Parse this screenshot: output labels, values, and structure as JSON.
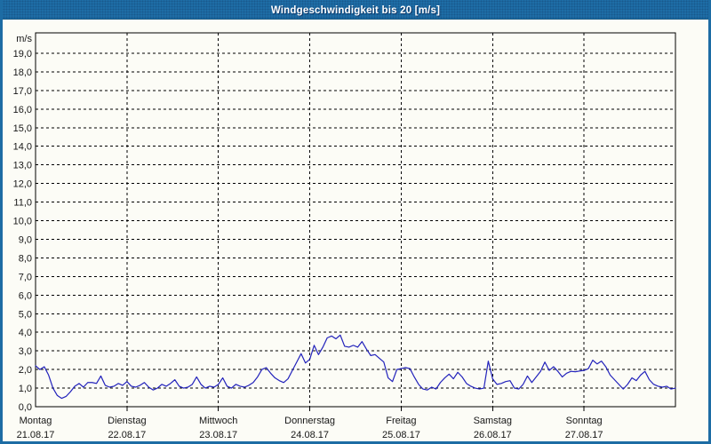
{
  "window": {
    "title": "Windgeschwindigkeit bis 20 [m/s]",
    "titlebar_color": "#1e6da6",
    "border_color": "#1d6ca4",
    "background_color": "#fcfcf6"
  },
  "chart_data": {
    "type": "line",
    "title": "Windgeschwindigkeit bis 20 [m/s]",
    "unit_label": "m/s",
    "ylabel": "m/s",
    "ylim": [
      0,
      20
    ],
    "y_tick_step": 1.0,
    "y_tick_labels": [
      "0,0",
      "1,0",
      "2,0",
      "3,0",
      "4,0",
      "5,0",
      "6,0",
      "7,0",
      "8,0",
      "9,0",
      "10,0",
      "11,0",
      "12,0",
      "13,0",
      "14,0",
      "15,0",
      "16,0",
      "17,0",
      "18,0",
      "19,0"
    ],
    "grid": "dashed",
    "line_color": "#2222bb",
    "grid_color": "#000000",
    "x_axis_days": [
      {
        "name": "Montag",
        "date": "21.08.17"
      },
      {
        "name": "Dienstag",
        "date": "22.08.17"
      },
      {
        "name": "Mittwoch",
        "date": "23.08.17"
      },
      {
        "name": "Donnerstag",
        "date": "24.08.17"
      },
      {
        "name": "Freitag",
        "date": "25.08.17"
      },
      {
        "name": "Samstag",
        "date": "26.08.17"
      },
      {
        "name": "Sonntag",
        "date": "27.08.17"
      }
    ],
    "samples_per_day": 21,
    "series": [
      {
        "name": "Windgeschwindigkeit",
        "values": [
          2.2,
          2.0,
          2.15,
          1.7,
          1.0,
          0.6,
          0.45,
          0.55,
          0.8,
          1.1,
          1.25,
          1.05,
          1.3,
          1.3,
          1.25,
          1.65,
          1.15,
          1.05,
          1.1,
          1.25,
          1.15,
          1.35,
          1.1,
          1.05,
          1.15,
          1.3,
          1.05,
          0.9,
          1.0,
          1.2,
          1.1,
          1.25,
          1.45,
          1.1,
          1.0,
          1.05,
          1.2,
          1.6,
          1.2,
          1.0,
          1.1,
          1.05,
          1.2,
          1.55,
          1.1,
          1.0,
          1.2,
          1.1,
          1.05,
          1.15,
          1.3,
          1.6,
          2.0,
          2.1,
          1.8,
          1.55,
          1.4,
          1.3,
          1.5,
          1.95,
          2.4,
          2.85,
          2.35,
          2.55,
          3.3,
          2.8,
          3.2,
          3.7,
          3.8,
          3.65,
          3.85,
          3.25,
          3.2,
          3.3,
          3.2,
          3.5,
          3.1,
          2.75,
          2.8,
          2.6,
          2.4,
          1.55,
          1.35,
          2.0,
          2.05,
          2.1,
          2.05,
          1.6,
          1.2,
          0.95,
          0.9,
          1.05,
          0.95,
          1.3,
          1.55,
          1.75,
          1.5,
          1.85,
          1.6,
          1.25,
          1.1,
          1.0,
          0.95,
          1.0,
          2.45,
          1.5,
          1.2,
          1.25,
          1.35,
          1.4,
          1.0,
          0.95,
          1.2,
          1.65,
          1.3,
          1.6,
          1.9,
          2.4,
          1.95,
          2.15,
          1.9,
          1.6,
          1.8,
          1.9,
          1.88,
          1.92,
          1.95,
          2.05,
          2.5,
          2.3,
          2.45,
          2.15,
          1.7,
          1.45,
          1.2,
          0.95,
          1.2,
          1.55,
          1.4,
          1.7,
          1.9,
          1.45,
          1.2,
          1.1,
          1.05,
          1.1,
          0.95,
          1.0
        ]
      }
    ]
  }
}
